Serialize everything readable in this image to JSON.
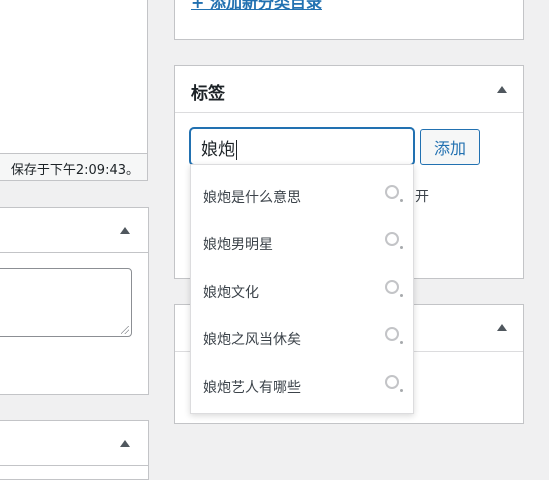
{
  "left": {
    "autosave_text": "保存于下午2:09:43。"
  },
  "category": {
    "add_new_link": "+ 添加新分类目录"
  },
  "tags": {
    "title": "标签",
    "input_value": "娘炮",
    "add_button": "添加",
    "partial_text": "开",
    "suggestions": [
      {
        "label": "娘炮是什么意思"
      },
      {
        "label": "娘炮男明星"
      },
      {
        "label": "娘炮文化"
      },
      {
        "label": "娘炮之风当休矣"
      },
      {
        "label": "娘炮艺人有哪些"
      }
    ]
  },
  "colors": {
    "accent": "#2271b1",
    "background": "#f0f0f1",
    "border": "#c3c4c7"
  }
}
